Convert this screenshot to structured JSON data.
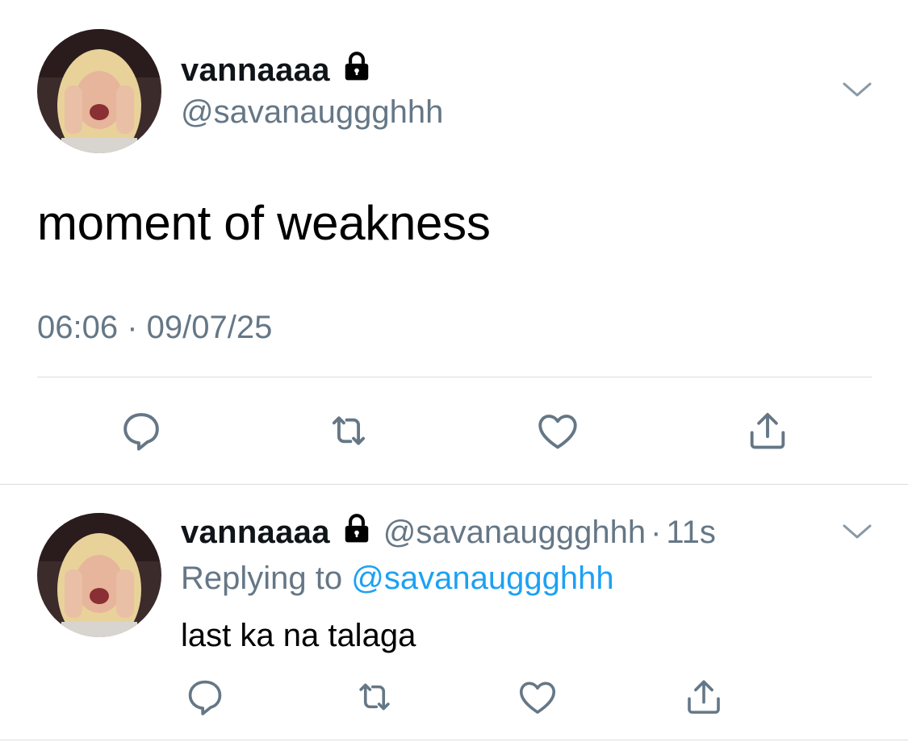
{
  "main_tweet": {
    "display_name": "vannaaaa",
    "handle": "@savanauggghhh",
    "text": "moment of weakness",
    "timestamp": "06:06 · 09/07/25",
    "icons": [
      "lock-icon",
      "chevron-down-icon",
      "reply-icon",
      "retweet-icon",
      "like-icon",
      "share-icon"
    ]
  },
  "reply_tweet": {
    "display_name": "vannaaaa",
    "handle": "@savanauggghhh",
    "separator": "·",
    "time_ago": "11s",
    "replying_prefix": "Replying to",
    "replying_to": "@savanauggghhh",
    "text": "last ka na talaga"
  },
  "colors": {
    "text": "#0f1419",
    "secondary": "#657786",
    "link": "#1da1f2",
    "divider": "#d9dde1"
  }
}
